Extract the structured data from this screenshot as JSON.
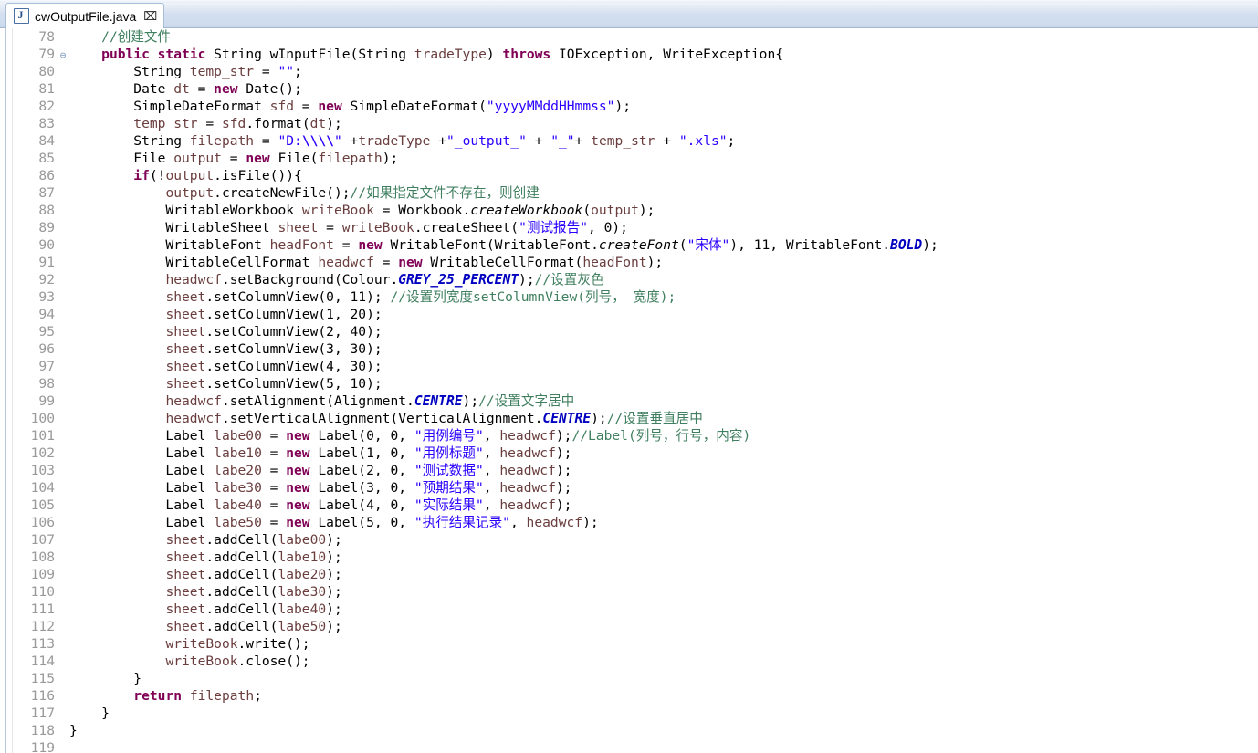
{
  "window": {
    "tab": {
      "label": "cwOutputFile.java",
      "icon": "java-file-icon",
      "close_glyph": "⌧"
    }
  },
  "editor": {
    "first_line": 78,
    "last_line": 119,
    "fold_glyph": "⊖",
    "colors": {
      "keyword": "#7f0055",
      "string": "#2a00ff",
      "comment": "#3f7f5f",
      "field": "#0000c0",
      "static_field": "#0000c0",
      "local_var": "#6a3e3e",
      "background": "#ffffff",
      "line_number": "#999999"
    },
    "lines": [
      {
        "n": "78",
        "fold": "",
        "html": "    <span class=\"cmt\">//创建文件</span>"
      },
      {
        "n": "79",
        "fold": "⊖",
        "html": "    <span class=\"kw\">public</span> <span class=\"kw\">static</span> String wInputFile(String <span class=\"var\">tradeType</span>) <span class=\"kw\">throws</span> IOException, WriteException{"
      },
      {
        "n": "80",
        "fold": "",
        "html": "        String <span class=\"var\">temp_str</span> = <span class=\"str\">\"\"</span>;"
      },
      {
        "n": "81",
        "fold": "",
        "html": "        Date <span class=\"var\">dt</span> = <span class=\"kw\">new</span> Date();"
      },
      {
        "n": "82",
        "fold": "",
        "html": "        SimpleDateFormat <span class=\"var\">sfd</span> = <span class=\"kw\">new</span> SimpleDateFormat(<span class=\"str\">\"yyyyMMddHHmmss\"</span>);"
      },
      {
        "n": "83",
        "fold": "",
        "html": "        <span class=\"var\">temp_str</span> = <span class=\"var\">sfd</span>.format(<span class=\"var\">dt</span>);"
      },
      {
        "n": "84",
        "fold": "",
        "html": "        String <span class=\"var\">filepath</span> = <span class=\"str\">\"D:<span class=\"esc\">\\\\\\\\</span>\"</span> +<span class=\"var\">tradeType</span> +<span class=\"str\">\"_output_\"</span> + <span class=\"str\">\"_\"</span>+ <span class=\"var\">temp_str</span> + <span class=\"str\">\".xls\"</span>;"
      },
      {
        "n": "85",
        "fold": "",
        "html": "        File <span class=\"var\">output</span> = <span class=\"kw\">new</span> File(<span class=\"var\">filepath</span>);"
      },
      {
        "n": "86",
        "fold": "",
        "html": "        <span class=\"kw\">if</span>(!<span class=\"var\">output</span>.isFile()){"
      },
      {
        "n": "87",
        "fold": "",
        "html": "            <span class=\"var\">output</span>.createNewFile();<span class=\"cmt\">//如果指定文件不存在，则创建</span>"
      },
      {
        "n": "88",
        "fold": "",
        "html": "            WritableWorkbook <span class=\"var\">writeBook</span> = Workbook.<span class=\"mth\">createWorkbook</span>(<span class=\"var\">output</span>);"
      },
      {
        "n": "89",
        "fold": "",
        "html": "            WritableSheet <span class=\"var\">sheet</span> = <span class=\"var\">writeBook</span>.createSheet(<span class=\"str\">\"测试报告\"</span>, 0);"
      },
      {
        "n": "90",
        "fold": "",
        "html": "            WritableFont <span class=\"var\">headFont</span> = <span class=\"kw\">new</span> WritableFont(WritableFont.<span class=\"mth\">createFont</span>(<span class=\"str\">\"宋体\"</span>), 11, WritableFont.<span class=\"stat\">BOLD</span>);"
      },
      {
        "n": "91",
        "fold": "",
        "html": "            WritableCellFormat <span class=\"var\">headwcf</span> = <span class=\"kw\">new</span> WritableCellFormat(<span class=\"var\">headFont</span>);"
      },
      {
        "n": "92",
        "fold": "",
        "html": "            <span class=\"var\">headwcf</span>.setBackground(Colour.<span class=\"stat\">GREY_25_PERCENT</span>);<span class=\"cmt\">//设置灰色</span>"
      },
      {
        "n": "93",
        "fold": "",
        "html": "            <span class=\"var\">sheet</span>.setColumnView(0, 11); <span class=\"cmt\">//设置列宽度setColumnView(列号， 宽度);</span>"
      },
      {
        "n": "94",
        "fold": "",
        "html": "            <span class=\"var\">sheet</span>.setColumnView(1, 20);"
      },
      {
        "n": "95",
        "fold": "",
        "html": "            <span class=\"var\">sheet</span>.setColumnView(2, 40);"
      },
      {
        "n": "96",
        "fold": "",
        "html": "            <span class=\"var\">sheet</span>.setColumnView(3, 30);"
      },
      {
        "n": "97",
        "fold": "",
        "html": "            <span class=\"var\">sheet</span>.setColumnView(4, 30);"
      },
      {
        "n": "98",
        "fold": "",
        "html": "            <span class=\"var\">sheet</span>.setColumnView(5, 10);"
      },
      {
        "n": "99",
        "fold": "",
        "html": "            <span class=\"var\">headwcf</span>.setAlignment(Alignment.<span class=\"stat\">CENTRE</span>);<span class=\"cmt\">//设置文字居中</span>"
      },
      {
        "n": "100",
        "fold": "",
        "html": "            <span class=\"var\">headwcf</span>.setVerticalAlignment(VerticalAlignment.<span class=\"stat\">CENTRE</span>);<span class=\"cmt\">//设置垂直居中</span>"
      },
      {
        "n": "101",
        "fold": "",
        "html": "            Label <span class=\"var\">labe00</span> = <span class=\"kw\">new</span> Label(0, 0, <span class=\"str\">\"用例编号\"</span>, <span class=\"var\">headwcf</span>);<span class=\"cmt\">//Label(列号，行号，内容)</span>"
      },
      {
        "n": "102",
        "fold": "",
        "html": "            Label <span class=\"var\">labe10</span> = <span class=\"kw\">new</span> Label(1, 0, <span class=\"str\">\"用例标题\"</span>, <span class=\"var\">headwcf</span>);"
      },
      {
        "n": "103",
        "fold": "",
        "html": "            Label <span class=\"var\">labe20</span> = <span class=\"kw\">new</span> Label(2, 0, <span class=\"str\">\"测试数据\"</span>, <span class=\"var\">headwcf</span>);"
      },
      {
        "n": "104",
        "fold": "",
        "html": "            Label <span class=\"var\">labe30</span> = <span class=\"kw\">new</span> Label(3, 0, <span class=\"str\">\"预期结果\"</span>, <span class=\"var\">headwcf</span>);"
      },
      {
        "n": "105",
        "fold": "",
        "html": "            Label <span class=\"var\">labe40</span> = <span class=\"kw\">new</span> Label(4, 0, <span class=\"str\">\"实际结果\"</span>, <span class=\"var\">headwcf</span>);"
      },
      {
        "n": "106",
        "fold": "",
        "html": "            Label <span class=\"var\">labe50</span> = <span class=\"kw\">new</span> Label(5, 0, <span class=\"str\">\"执行结果记录\"</span>, <span class=\"var\">headwcf</span>);"
      },
      {
        "n": "107",
        "fold": "",
        "html": "            <span class=\"var\">sheet</span>.addCell(<span class=\"var\">labe00</span>);"
      },
      {
        "n": "108",
        "fold": "",
        "html": "            <span class=\"var\">sheet</span>.addCell(<span class=\"var\">labe10</span>);"
      },
      {
        "n": "109",
        "fold": "",
        "html": "            <span class=\"var\">sheet</span>.addCell(<span class=\"var\">labe20</span>);"
      },
      {
        "n": "110",
        "fold": "",
        "html": "            <span class=\"var\">sheet</span>.addCell(<span class=\"var\">labe30</span>);"
      },
      {
        "n": "111",
        "fold": "",
        "html": "            <span class=\"var\">sheet</span>.addCell(<span class=\"var\">labe40</span>);"
      },
      {
        "n": "112",
        "fold": "",
        "html": "            <span class=\"var\">sheet</span>.addCell(<span class=\"var\">labe50</span>);"
      },
      {
        "n": "113",
        "fold": "",
        "html": "            <span class=\"var\">writeBook</span>.write();"
      },
      {
        "n": "114",
        "fold": "",
        "html": "            <span class=\"var\">writeBook</span>.close();"
      },
      {
        "n": "115",
        "fold": "",
        "html": "        }"
      },
      {
        "n": "116",
        "fold": "",
        "html": "        <span class=\"kw\">return</span> <span class=\"var\">filepath</span>;"
      },
      {
        "n": "117",
        "fold": "",
        "html": "    }"
      },
      {
        "n": "118",
        "fold": "",
        "html": "}"
      },
      {
        "n": "119",
        "fold": "",
        "html": ""
      }
    ]
  }
}
